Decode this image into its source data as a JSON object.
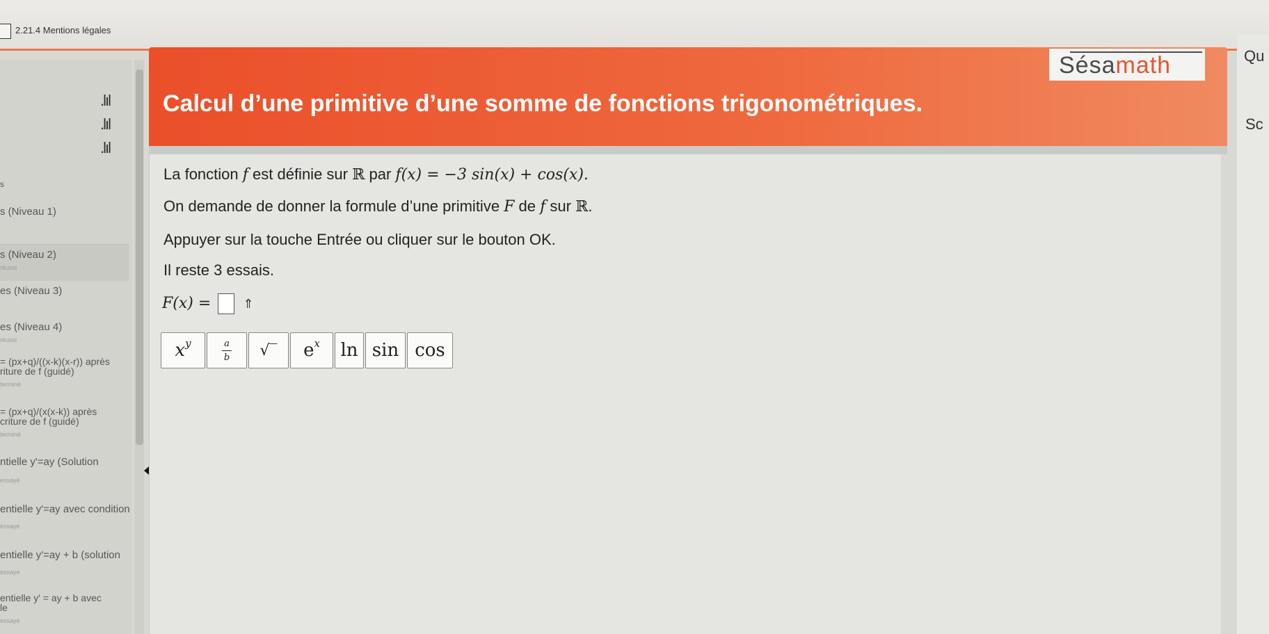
{
  "topbar": {
    "label": "2.21.4  Mentions légales"
  },
  "sidebar": {
    "items": [
      {
        "label": "s (Niveau 1)",
        "sub": ""
      },
      {
        "label": "s (Niveau 2)",
        "sub": "réussi"
      },
      {
        "label": "es (Niveau 3)",
        "sub": ""
      },
      {
        "label": "es (Niveau 4)",
        "sub": "réussi"
      },
      {
        "label": "= (px+q)/((x-k)(x-r)) après",
        "label2": "riture de f (guidé)",
        "sub": "terminé"
      },
      {
        "label": "= (px+q)/(x(x-k)) après",
        "label2": "criture de f (guidé)",
        "sub": "terminé"
      },
      {
        "label": "ntielle y'=ay (Solution",
        "sub": "essayé"
      },
      {
        "label": "entielle y'=ay avec condition",
        "sub": "essayé"
      },
      {
        "label": "entielle y'=ay + b (solution",
        "sub": "essayé"
      },
      {
        "label": "entielle y' = ay + b avec",
        "label2": "le",
        "sub": "essayé"
      }
    ],
    "bar_glyph": ".lıl",
    "lone_char": "s"
  },
  "banner": {
    "title": "Calcul d’une primitive d’une somme de fonctions trigonométriques.",
    "logo_prefix": "Sésa",
    "logo_suffix": "math"
  },
  "right_panel": {
    "text1": "Qu",
    "text2": "Sc"
  },
  "exercise": {
    "line1_prefix": "La fonction ",
    "f_symbol": "f",
    "line1_mid": " est définie sur ",
    "R_symbol": "ℝ",
    "line1_par": " par ",
    "formula": "f(x) = −3 sin(x) + cos(x).",
    "line2_prefix": "On demande de donner la formule d’une primitive ",
    "F_symbol": "F",
    "line2_mid": " de ",
    "line2_sur": " sur ",
    "line2_end": ".",
    "line3": "Appuyer sur la touche Entrée ou cliquer sur le bouton OK.",
    "line4": "Il reste 3 essais.",
    "answer_label": "F(x) =",
    "up_icon": "⇑"
  },
  "keypad": {
    "keys": [
      {
        "name": "power",
        "base": "x",
        "sup": "y"
      },
      {
        "name": "fraction",
        "num": "a",
        "den": "b"
      },
      {
        "name": "sqrt",
        "label": "√‾"
      },
      {
        "name": "exp",
        "base": "e",
        "sup": "x"
      },
      {
        "name": "ln",
        "label": "ln"
      },
      {
        "name": "sin",
        "label": "sin"
      },
      {
        "name": "cos",
        "label": "cos"
      }
    ]
  },
  "colors": {
    "banner": "#ea4f2a",
    "accent": "#e87a4e",
    "content_bg": "#e5e6e2"
  }
}
